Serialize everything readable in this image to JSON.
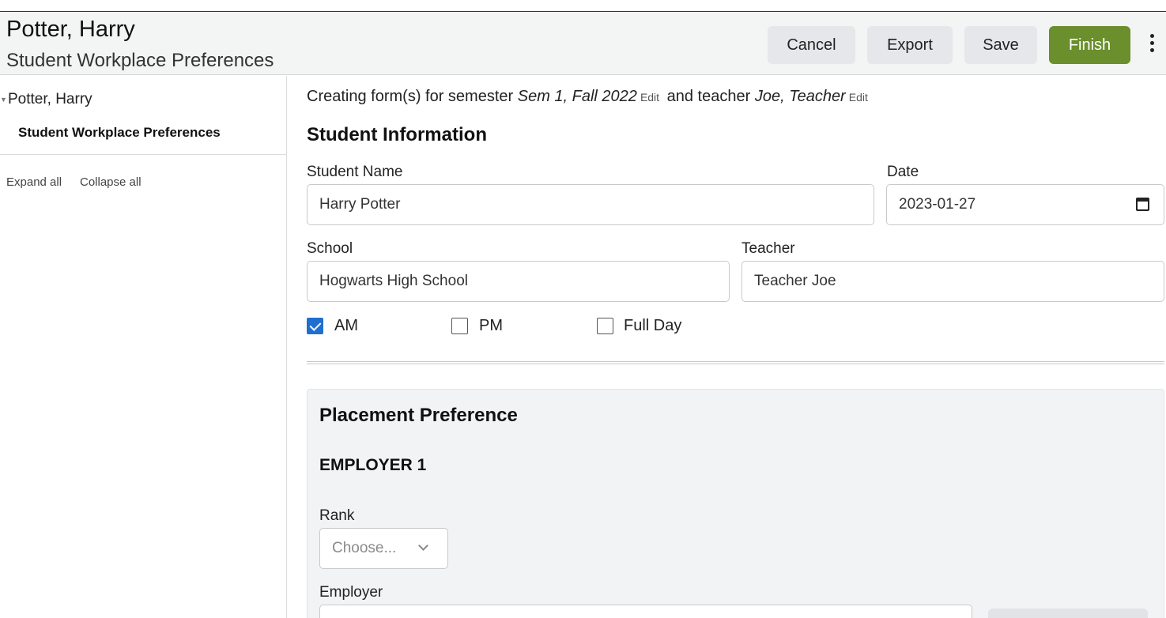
{
  "header": {
    "title": "Potter, Harry",
    "subtitle": "Student Workplace Preferences",
    "buttons": {
      "cancel": "Cancel",
      "export": "Export",
      "save": "Save",
      "finish": "Finish"
    },
    "more_icon": "kebab-menu-icon"
  },
  "sidebar": {
    "tree_root": "Potter, Harry",
    "tree_child": "Student Workplace Preferences",
    "expand_all": "Expand all",
    "collapse_all": "Collapse all"
  },
  "intro": {
    "prefix": "Creating form(s) for semester",
    "semester": "Sem 1, Fall 2022",
    "edit": "Edit",
    "middle": "and teacher",
    "teacher": "Joe, Teacher"
  },
  "student_info": {
    "title": "Student Information",
    "name_label": "Student Name",
    "name_value": "Harry Potter",
    "date_label": "Date",
    "date_value": "2023-01-27",
    "school_label": "School",
    "school_value": "Hogwarts High School",
    "teacher_label": "Teacher",
    "teacher_value": "Teacher Joe",
    "sessions": [
      {
        "label": "AM",
        "checked": true
      },
      {
        "label": "PM",
        "checked": false
      },
      {
        "label": "Full Day",
        "checked": false
      }
    ]
  },
  "placement": {
    "title": "Placement Preference",
    "employer_heading": "EMPLOYER 1",
    "rank_label": "Rank",
    "rank_placeholder": "Choose...",
    "employer_label": "Employer"
  },
  "colors": {
    "finish_bg": "#6a8f2c",
    "checkbox_checked": "#1f6fd1",
    "header_bg": "#f3f4f4",
    "panel_bg": "#f2f3f4"
  }
}
